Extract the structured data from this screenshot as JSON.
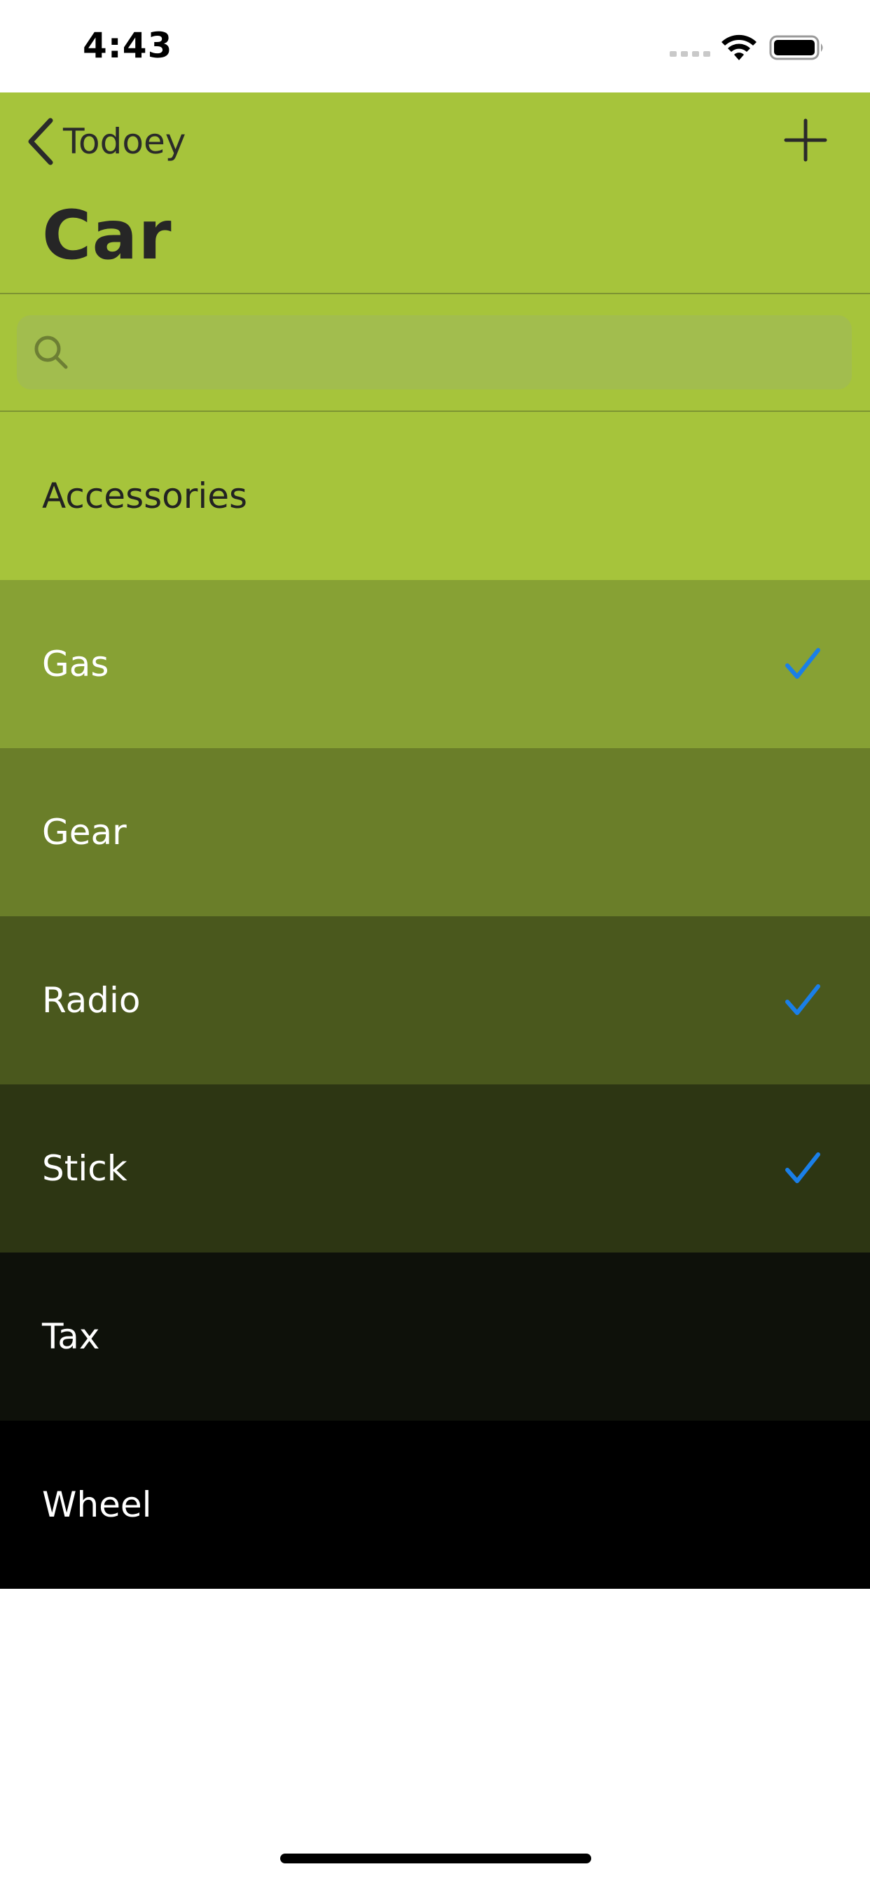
{
  "status_bar": {
    "time": "4:43",
    "signal_icon": "signal-dots-icon",
    "wifi_icon": "wifi-icon",
    "battery_icon": "battery-icon"
  },
  "nav": {
    "back_label": "Todoey",
    "back_icon": "chevron-left-icon",
    "add_icon": "plus-icon",
    "title": "Car",
    "bar_color": "#a6c43b"
  },
  "search": {
    "placeholder": "",
    "value": "",
    "icon": "search-icon"
  },
  "items": [
    {
      "label": "Accessories",
      "done": false,
      "bg": "#a6c43b",
      "text_color": "#222222"
    },
    {
      "label": "Gas",
      "done": true,
      "bg": "#87a134",
      "text_color": "#ffffff"
    },
    {
      "label": "Gear",
      "done": false,
      "bg": "#6a7e29",
      "text_color": "#ffffff"
    },
    {
      "label": "Radio",
      "done": true,
      "bg": "#4a581d",
      "text_color": "#ffffff"
    },
    {
      "label": "Stick",
      "done": true,
      "bg": "#2d3613",
      "text_color": "#ffffff"
    },
    {
      "label": "Tax",
      "done": false,
      "bg": "#0e110a",
      "text_color": "#ffffff"
    },
    {
      "label": "Wheel",
      "done": false,
      "bg": "#000000",
      "text_color": "#ffffff"
    }
  ],
  "checkmark_color": "#1a7fe8"
}
